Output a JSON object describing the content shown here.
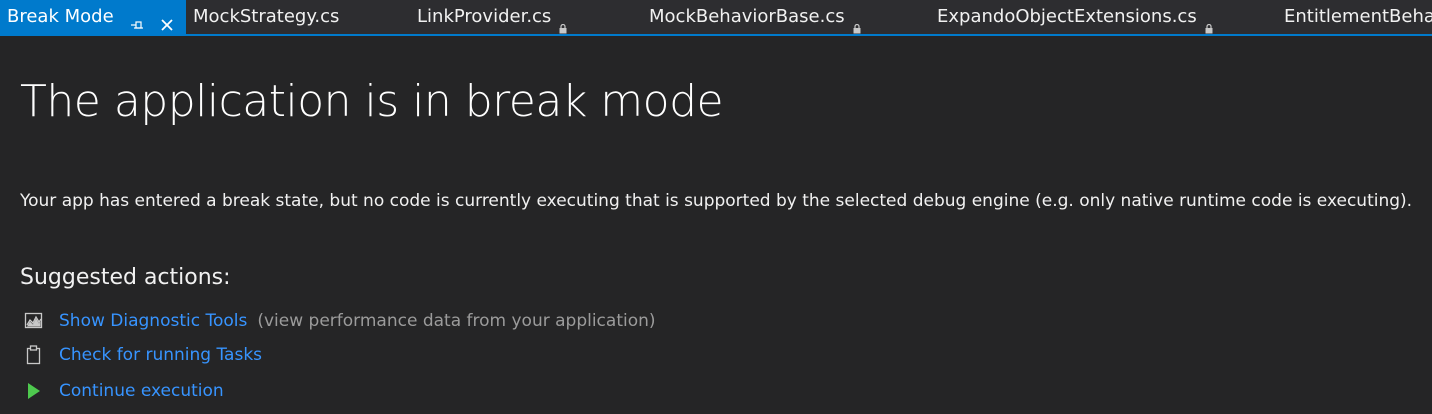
{
  "tabs": [
    {
      "label": "Break Mode",
      "active": true,
      "pinned": true,
      "closable": true
    },
    {
      "label": "MockStrategy.cs",
      "locked": false
    },
    {
      "label": "LinkProvider.cs",
      "locked": true
    },
    {
      "label": "MockBehaviorBase.cs",
      "locked": true
    },
    {
      "label": "ExpandoObjectExtensions.cs",
      "locked": true
    },
    {
      "label": "EntitlementBeha",
      "locked": false
    }
  ],
  "main": {
    "title": "The application is in break mode",
    "description": "Your app has entered a break state, but no code is currently executing that is supported by the selected debug engine (e.g. only native runtime code is executing).",
    "suggested_heading": "Suggested actions:",
    "actions": [
      {
        "icon": "diagnostic-tools-icon",
        "label": "Show Diagnostic Tools",
        "hint": "(view performance data from your application)"
      },
      {
        "icon": "clipboard-icon",
        "label": "Check for running Tasks",
        "hint": ""
      },
      {
        "icon": "play-icon",
        "label": "Continue execution",
        "hint": ""
      }
    ]
  },
  "colors": {
    "accent": "#007acc",
    "background": "#252526",
    "tabbar": "#2d2d30",
    "link": "#3794ff",
    "play_green": "#4ec94e"
  }
}
